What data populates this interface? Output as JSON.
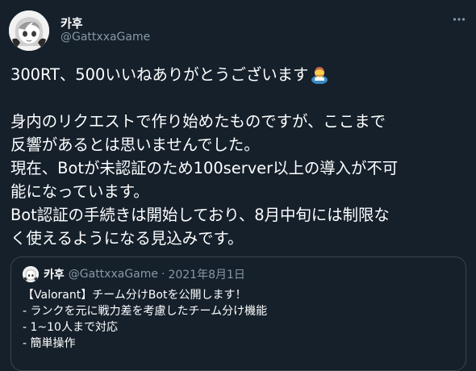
{
  "author": {
    "display_name": "카후",
    "handle": "@GattxxaGame",
    "avatar_icon": "anime-avatar-icon"
  },
  "more_icon": "more-horizontal-icon",
  "tweet": {
    "line1": "300RT、500いいねありがとうございます",
    "line1_emoji": "bowing-person-emoji",
    "line2": "身内のリクエストで作り始めたものですが、ここまで",
    "line3": "反響があるとは思いませんでした。",
    "line4": "現在、Botが未認証のため100server以上の導入が不可",
    "line5": "能になっています。",
    "line6": "Bot認証の手続きは開始しており、8月中旬には制限な",
    "line7": "く使えるようになる見込みです。"
  },
  "quote": {
    "display_name": "카후",
    "handle": "@GattxxaGame",
    "separator": "·",
    "date": "2021年8月1日",
    "lines": [
      "【Valorant】チーム分けBotを公開します！",
      "- ランクを元に戦力差を考慮したチーム分け機能",
      "- 1~10人まで対応",
      "- 簡単操作"
    ]
  },
  "colors": {
    "background": "#15202b",
    "text": "#ffffff",
    "secondary": "#8899a6",
    "border": "#38444d"
  }
}
